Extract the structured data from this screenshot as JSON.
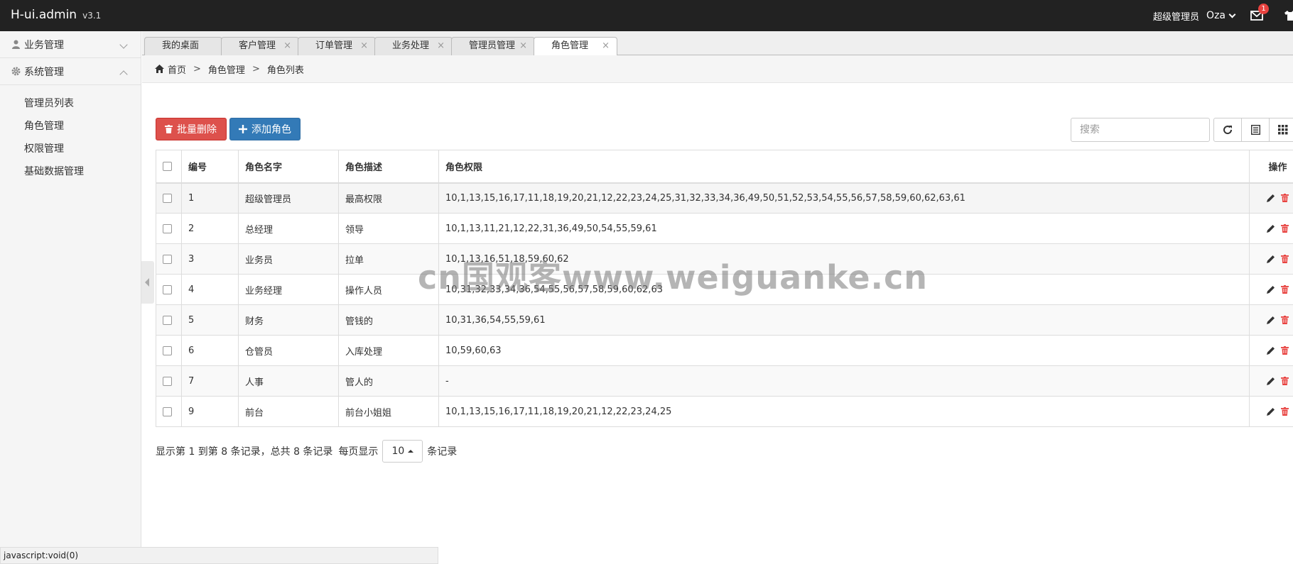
{
  "app": {
    "name": "H-ui.admin",
    "version": "v3.1"
  },
  "topbar": {
    "role": "超级管理员",
    "user": "Oza",
    "mail_badge": "1"
  },
  "sidebar": {
    "groups": [
      {
        "label": "业务管理",
        "expanded": false
      },
      {
        "label": "系统管理",
        "expanded": true
      }
    ],
    "sub_items": [
      "管理员列表",
      "角色管理",
      "权限管理",
      "基础数据管理"
    ]
  },
  "tabs": [
    {
      "label": "我的桌面",
      "closable": false
    },
    {
      "label": "客户管理",
      "closable": true
    },
    {
      "label": "订单管理",
      "closable": true
    },
    {
      "label": "业务处理",
      "closable": true
    },
    {
      "label": "管理员管理",
      "closable": true
    },
    {
      "label": "角色管理",
      "closable": true,
      "active": true
    }
  ],
  "tab_close": "×",
  "breadcrumb": {
    "home": "首页",
    "sep": ">",
    "level1": "角色管理",
    "level2": "角色列表"
  },
  "toolbar": {
    "batch_delete": "批量删除",
    "add_role": "添加角色",
    "search_placeholder": "搜索"
  },
  "table": {
    "headers": [
      "编号",
      "角色名字",
      "角色描述",
      "角色权限",
      "操作"
    ],
    "rows": [
      {
        "id": "1",
        "name": "超级管理员",
        "desc": "最高权限",
        "perms": "10,1,13,15,16,17,11,18,19,20,21,12,22,23,24,25,31,32,33,34,36,49,50,51,52,53,54,55,56,57,58,59,60,62,63,61"
      },
      {
        "id": "2",
        "name": "总经理",
        "desc": "领导",
        "perms": "10,1,13,11,21,12,22,31,36,49,50,54,55,59,61"
      },
      {
        "id": "3",
        "name": "业务员",
        "desc": "拉单",
        "perms": "10,1,13,16,51,18,59,60,62"
      },
      {
        "id": "4",
        "name": "业务经理",
        "desc": "操作人员",
        "perms": "10,31,32,33,34,36,54,55,56,57,58,59,60,62,63"
      },
      {
        "id": "5",
        "name": "财务",
        "desc": "管钱的",
        "perms": "10,31,36,54,55,59,61"
      },
      {
        "id": "6",
        "name": "仓管员",
        "desc": "入库处理",
        "perms": "10,59,60,63"
      },
      {
        "id": "7",
        "name": "人事",
        "desc": "管人的",
        "perms": "-"
      },
      {
        "id": "9",
        "name": "前台",
        "desc": "前台小姐姐",
        "perms": "10,1,13,15,16,17,11,18,19,20,21,12,22,23,24,25"
      }
    ]
  },
  "pagination": {
    "summary": "显示第 1 到第 8 条记录，总共 8 条记录",
    "per_page_prefix": "每页显示",
    "per_page": "10",
    "per_page_suffix": "条记录"
  },
  "status_bar": "javascript:void(0)",
  "watermark": "cn国观客www.weiguanke.cn",
  "colors": {
    "topbar": "#222222",
    "danger": "#dd514c",
    "primary": "#337ab7",
    "delete_icon": "#e8423f"
  }
}
